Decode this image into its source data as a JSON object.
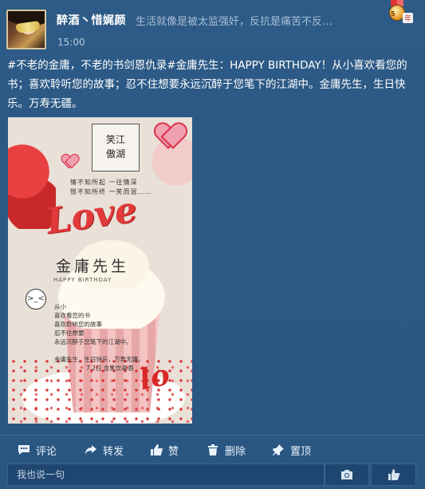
{
  "post": {
    "username": "醉酒丶惜娓颜",
    "signature": "生活就像是被太监强奸，反抗是痛苦不反…",
    "time": "15:00",
    "badge_number": "5",
    "badge_year": "年",
    "text": "#不老的金庸，不老的书剑恩仇录#金庸先生：HAPPY BIRTHDAY！从小喜欢看您的书；喜欢聆听您的故事；忍不住想要永远沉醉于您笔下的江湖中。金庸先生，生日快乐。万寿无疆。"
  },
  "photo": {
    "box_title_1": "笑江",
    "box_title_2": "傲湖",
    "poem_line_1": "情不知所起 一往情深",
    "poem_line_2": "恨不知所终 一笑而泯……",
    "love_word": "Love",
    "cake_title": "金庸先生",
    "happy_birthday": "HAPPY BIRTHDAY",
    "face": ">_<",
    "note_lines": [
      "从小",
      "喜欢看您的书",
      "喜欢聆听您的故事",
      "忍不住想要",
      "永远沉醉于您笔下的江湖中。"
    ],
    "sign_line_1": "金庸先生，生日快乐，万寿无疆。",
    "sign_line_2": "7.2日 含笑饮毒酒",
    "lo_word": "lo"
  },
  "actions": {
    "comment": "评论",
    "forward": "转发",
    "like": "赞",
    "delete": "删除",
    "pin": "置顶"
  },
  "comment_box": {
    "placeholder": "我也说一句"
  },
  "icons": {
    "camera": "camera-icon",
    "thumbs": "thumbs-up-hand-icon"
  }
}
